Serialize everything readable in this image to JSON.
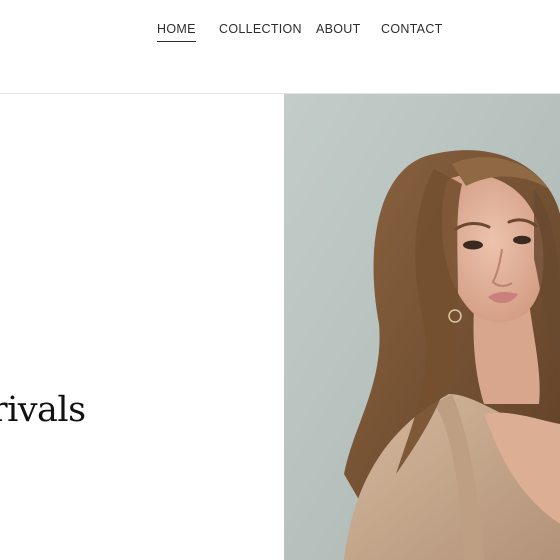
{
  "nav": {
    "items": [
      {
        "label": "HOME",
        "active": true
      },
      {
        "label": "COLLECTION",
        "active": false
      },
      {
        "label": "ABOUT",
        "active": false
      },
      {
        "label": "CONTACT",
        "active": false
      }
    ]
  },
  "hero": {
    "headline": "zy Arrivals",
    "image_subject": "model-portrait",
    "colors": {
      "background_wall": "#b9c4c0",
      "hair": "#7a5535",
      "skin": "#e2b39c",
      "jacket": "#c9ab8f",
      "lips": "#c9807a"
    }
  }
}
